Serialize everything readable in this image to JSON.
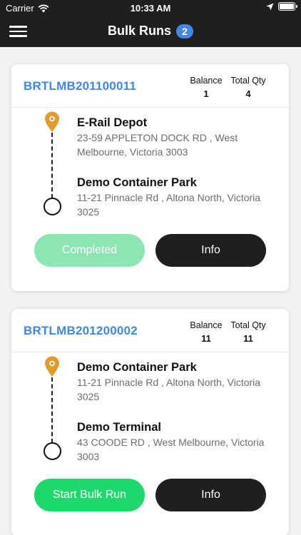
{
  "status_bar": {
    "carrier": "Carrier",
    "time": "10:33 AM"
  },
  "nav": {
    "title": "Bulk Runs",
    "badge": "2"
  },
  "colors": {
    "accent_blue": "#3f87ea",
    "pin_orange": "#e09a2e",
    "completed_green": "#8be6b3",
    "start_green": "#1ed86c",
    "dark": "#1f1f21"
  },
  "runs": [
    {
      "id": "BRTLMB201100011",
      "balance_label": "Balance",
      "balance": "1",
      "total_label": "Total Qty",
      "total": "4",
      "from": {
        "name": "E-Rail Depot",
        "address": "23-59 APPLETON DOCK RD , West Melbourne, Victoria 3003"
      },
      "to": {
        "name": "Demo Container Park",
        "address": "11-21 Pinnacle Rd , Altona North, Victoria 3025"
      },
      "primary_label": "Completed",
      "info_label": "Info"
    },
    {
      "id": "BRTLMB201200002",
      "balance_label": "Balance",
      "balance": "11",
      "total_label": "Total Qty",
      "total": "11",
      "from": {
        "name": "Demo Container Park",
        "address": "11-21 Pinnacle Rd , Altona North, Victoria 3025"
      },
      "to": {
        "name": "Demo Terminal",
        "address": "43 COODE RD , West Melbourne, Victoria 3003"
      },
      "primary_label": "Start Bulk Run",
      "info_label": "Info"
    }
  ]
}
